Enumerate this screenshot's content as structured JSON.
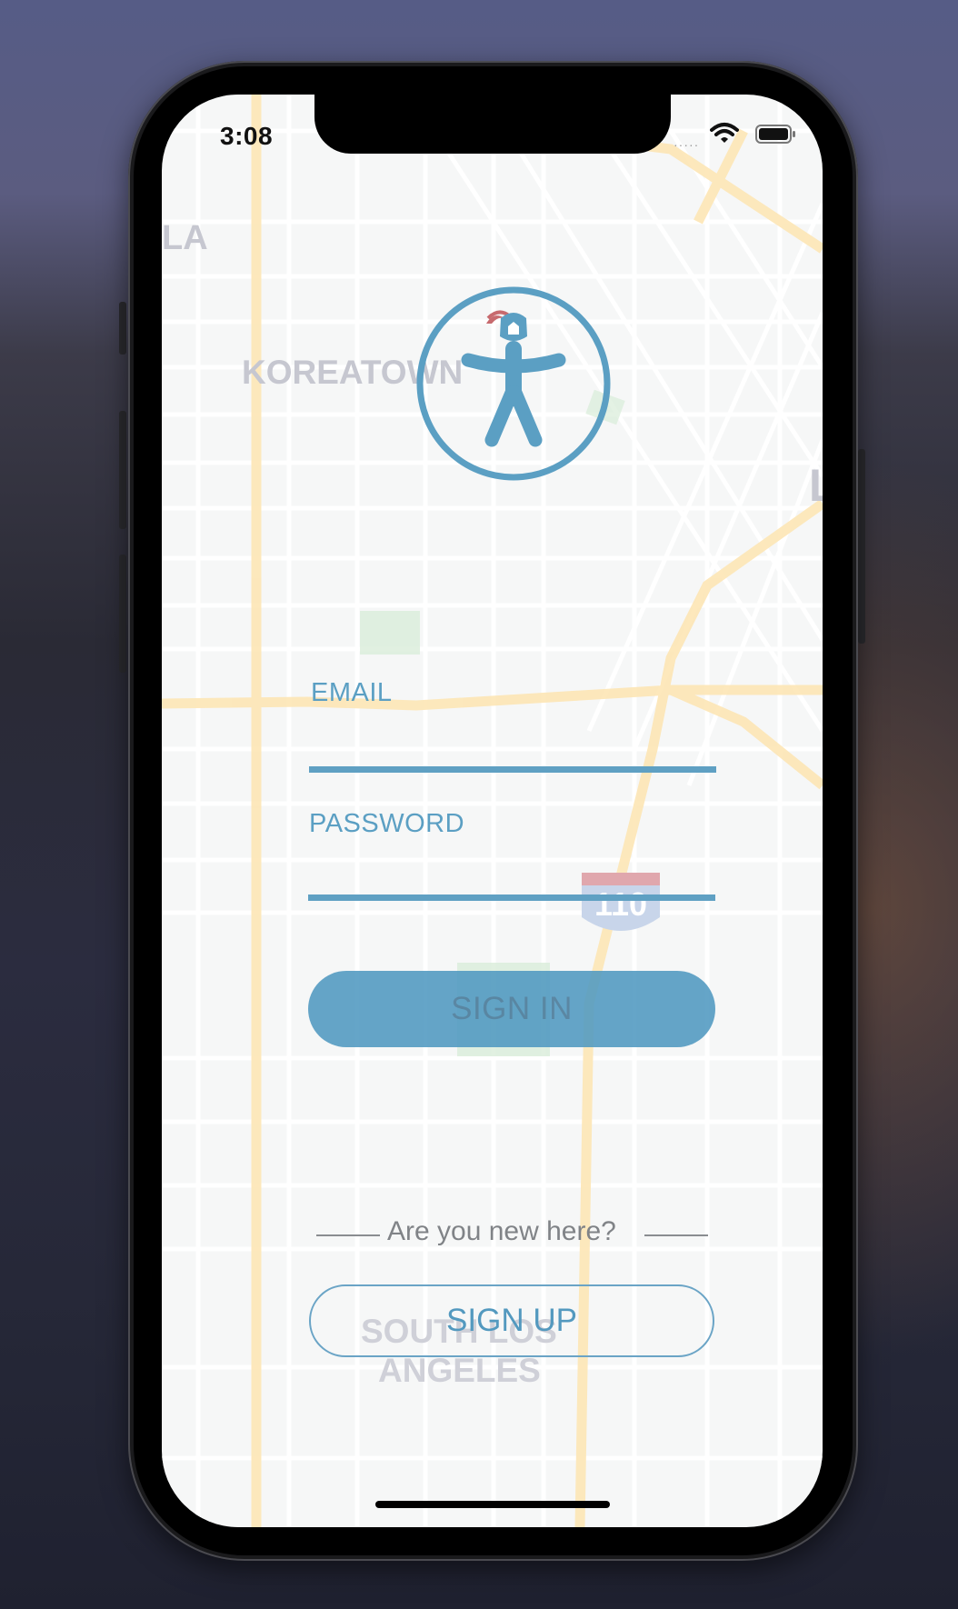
{
  "status_bar": {
    "time": "3:08",
    "signal_dots": "·····",
    "wifi_icon": "wifi-icon",
    "battery_icon": "battery-icon"
  },
  "map": {
    "labels": {
      "la": "LA",
      "koreatown": "KOREATOWN",
      "south_la_line1": "SOUTH LOS",
      "south_la_line2": "ANGELES",
      "highway_shield": "110",
      "edge_letter": "L"
    }
  },
  "logo": {
    "icon": "person-with-helmet-logo-icon"
  },
  "form": {
    "email_label": "EMAIL",
    "email_value": "",
    "password_label": "PASSWORD",
    "password_value": "",
    "signin_label": "SIGN IN"
  },
  "signup": {
    "prompt": "Are you new here?",
    "button_label": "SIGN UP"
  },
  "colors": {
    "accent": "#5fa0c3",
    "screen_bg": "#f6f7f7",
    "divider": "#8a8d91",
    "highway": "#fde6b5",
    "park": "#d9ecd9"
  }
}
